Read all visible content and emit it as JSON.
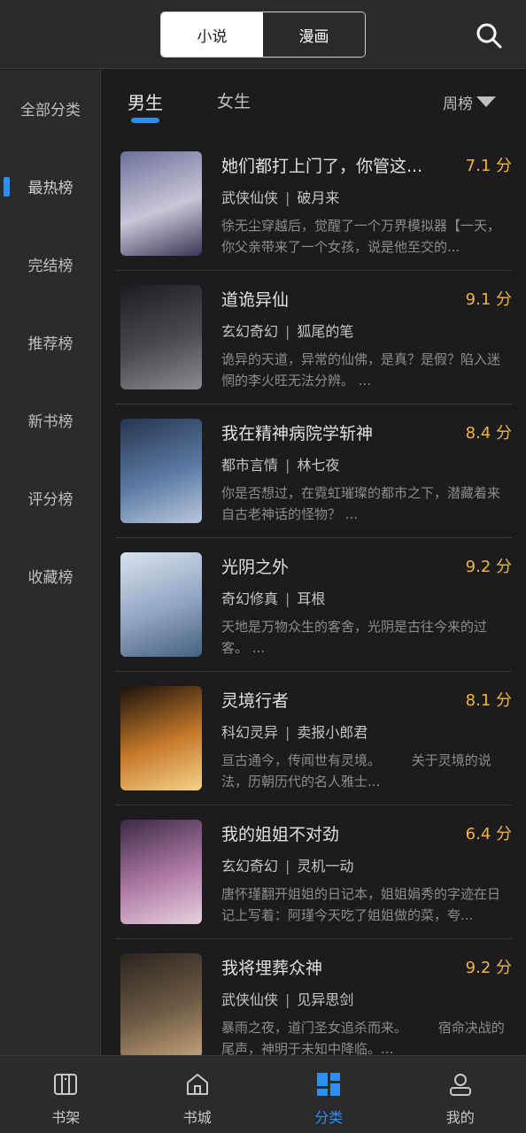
{
  "header": {
    "tabs": [
      {
        "label": "小说",
        "active": true
      },
      {
        "label": "漫画",
        "active": false
      }
    ],
    "search_icon": "search-icon"
  },
  "sidebar": {
    "items": [
      {
        "label": "全部分类"
      },
      {
        "label": "最热榜",
        "active": true
      },
      {
        "label": "完结榜"
      },
      {
        "label": "推荐榜"
      },
      {
        "label": "新书榜"
      },
      {
        "label": "评分榜"
      },
      {
        "label": "收藏榜"
      }
    ]
  },
  "gender_tabs": [
    {
      "label": "男生",
      "active": true
    },
    {
      "label": "女生",
      "active": false
    }
  ],
  "rank_period": "周榜",
  "books": [
    {
      "title": "她们都打上门了，你管这...",
      "score": "7.1 分",
      "genre": "武侠仙侠",
      "author": "破月来",
      "desc": "徐无尘穿越后，觉醒了一个万界模拟器【一天，你父亲带来了一个女孩，说是他至交的...",
      "cover_colors": [
        "#6d6f9a",
        "#c9c6d8",
        "#3b3556"
      ]
    },
    {
      "title": "道诡异仙",
      "score": "9.1 分",
      "genre": "玄幻奇幻",
      "author": "狐尾的笔",
      "desc": "诡异的天道，异常的仙佛，是真？是假？陷入迷惘的李火旺无法分辨。 ...",
      "cover_colors": [
        "#1b1d22",
        "#4a4c52",
        "#8a8c90"
      ]
    },
    {
      "title": "我在精神病院学斩神",
      "score": "8.4 分",
      "genre": "都市言情",
      "author": "林七夜",
      "desc": "你是否想过，在霓虹璀璨的都市之下，潜藏着来自古老神话的怪物？ ...",
      "cover_colors": [
        "#26354d",
        "#5b7aa5",
        "#b8c7dc"
      ]
    },
    {
      "title": "光阴之外",
      "score": "9.2 分",
      "genre": "奇幻修真",
      "author": "耳根",
      "desc": "天地是万物众生的客舍，光阴是古往今来的过客。 ...",
      "cover_colors": [
        "#d9e2ee",
        "#8fa5c2",
        "#45607f"
      ]
    },
    {
      "title": "灵境行者",
      "score": "8.1 分",
      "genre": "科幻灵异",
      "author": "卖报小郎君",
      "desc": "亘古通今，传闻世有灵境。\n　　关于灵境的说法，历朝历代的名人雅士...",
      "cover_colors": [
        "#1a120c",
        "#c77a2a",
        "#f5d38a"
      ]
    },
    {
      "title": "我的姐姐不对劲",
      "score": "6.4 分",
      "genre": "玄幻奇幻",
      "author": "灵机一动",
      "desc": "唐怀瑾翻开姐姐的日记本，姐姐娟秀的字迹在日记上写着：阿瑾今天吃了姐姐做的菜，夸...",
      "cover_colors": [
        "#3a2a44",
        "#b07aa8",
        "#e7d3dc"
      ]
    },
    {
      "title": "我将埋葬众神",
      "score": "9.2 分",
      "genre": "武侠仙侠",
      "author": "见异思剑",
      "desc": "暴雨之夜，道门圣女追杀而来。\n　　宿命决战的尾声，神明于未知中降临。...",
      "cover_colors": [
        "#2a2520",
        "#6e5a44",
        "#c2a27a"
      ]
    }
  ],
  "bottom_nav": [
    {
      "label": "书架",
      "icon": "bookshelf-icon"
    },
    {
      "label": "书城",
      "icon": "home-icon"
    },
    {
      "label": "分类",
      "icon": "category-icon",
      "active": true
    },
    {
      "label": "我的",
      "icon": "profile-icon"
    }
  ],
  "colors": {
    "accent": "#2e8ff0",
    "score": "#f2b53a",
    "background": "#1c1c1e",
    "panel": "#2b2b2d"
  }
}
